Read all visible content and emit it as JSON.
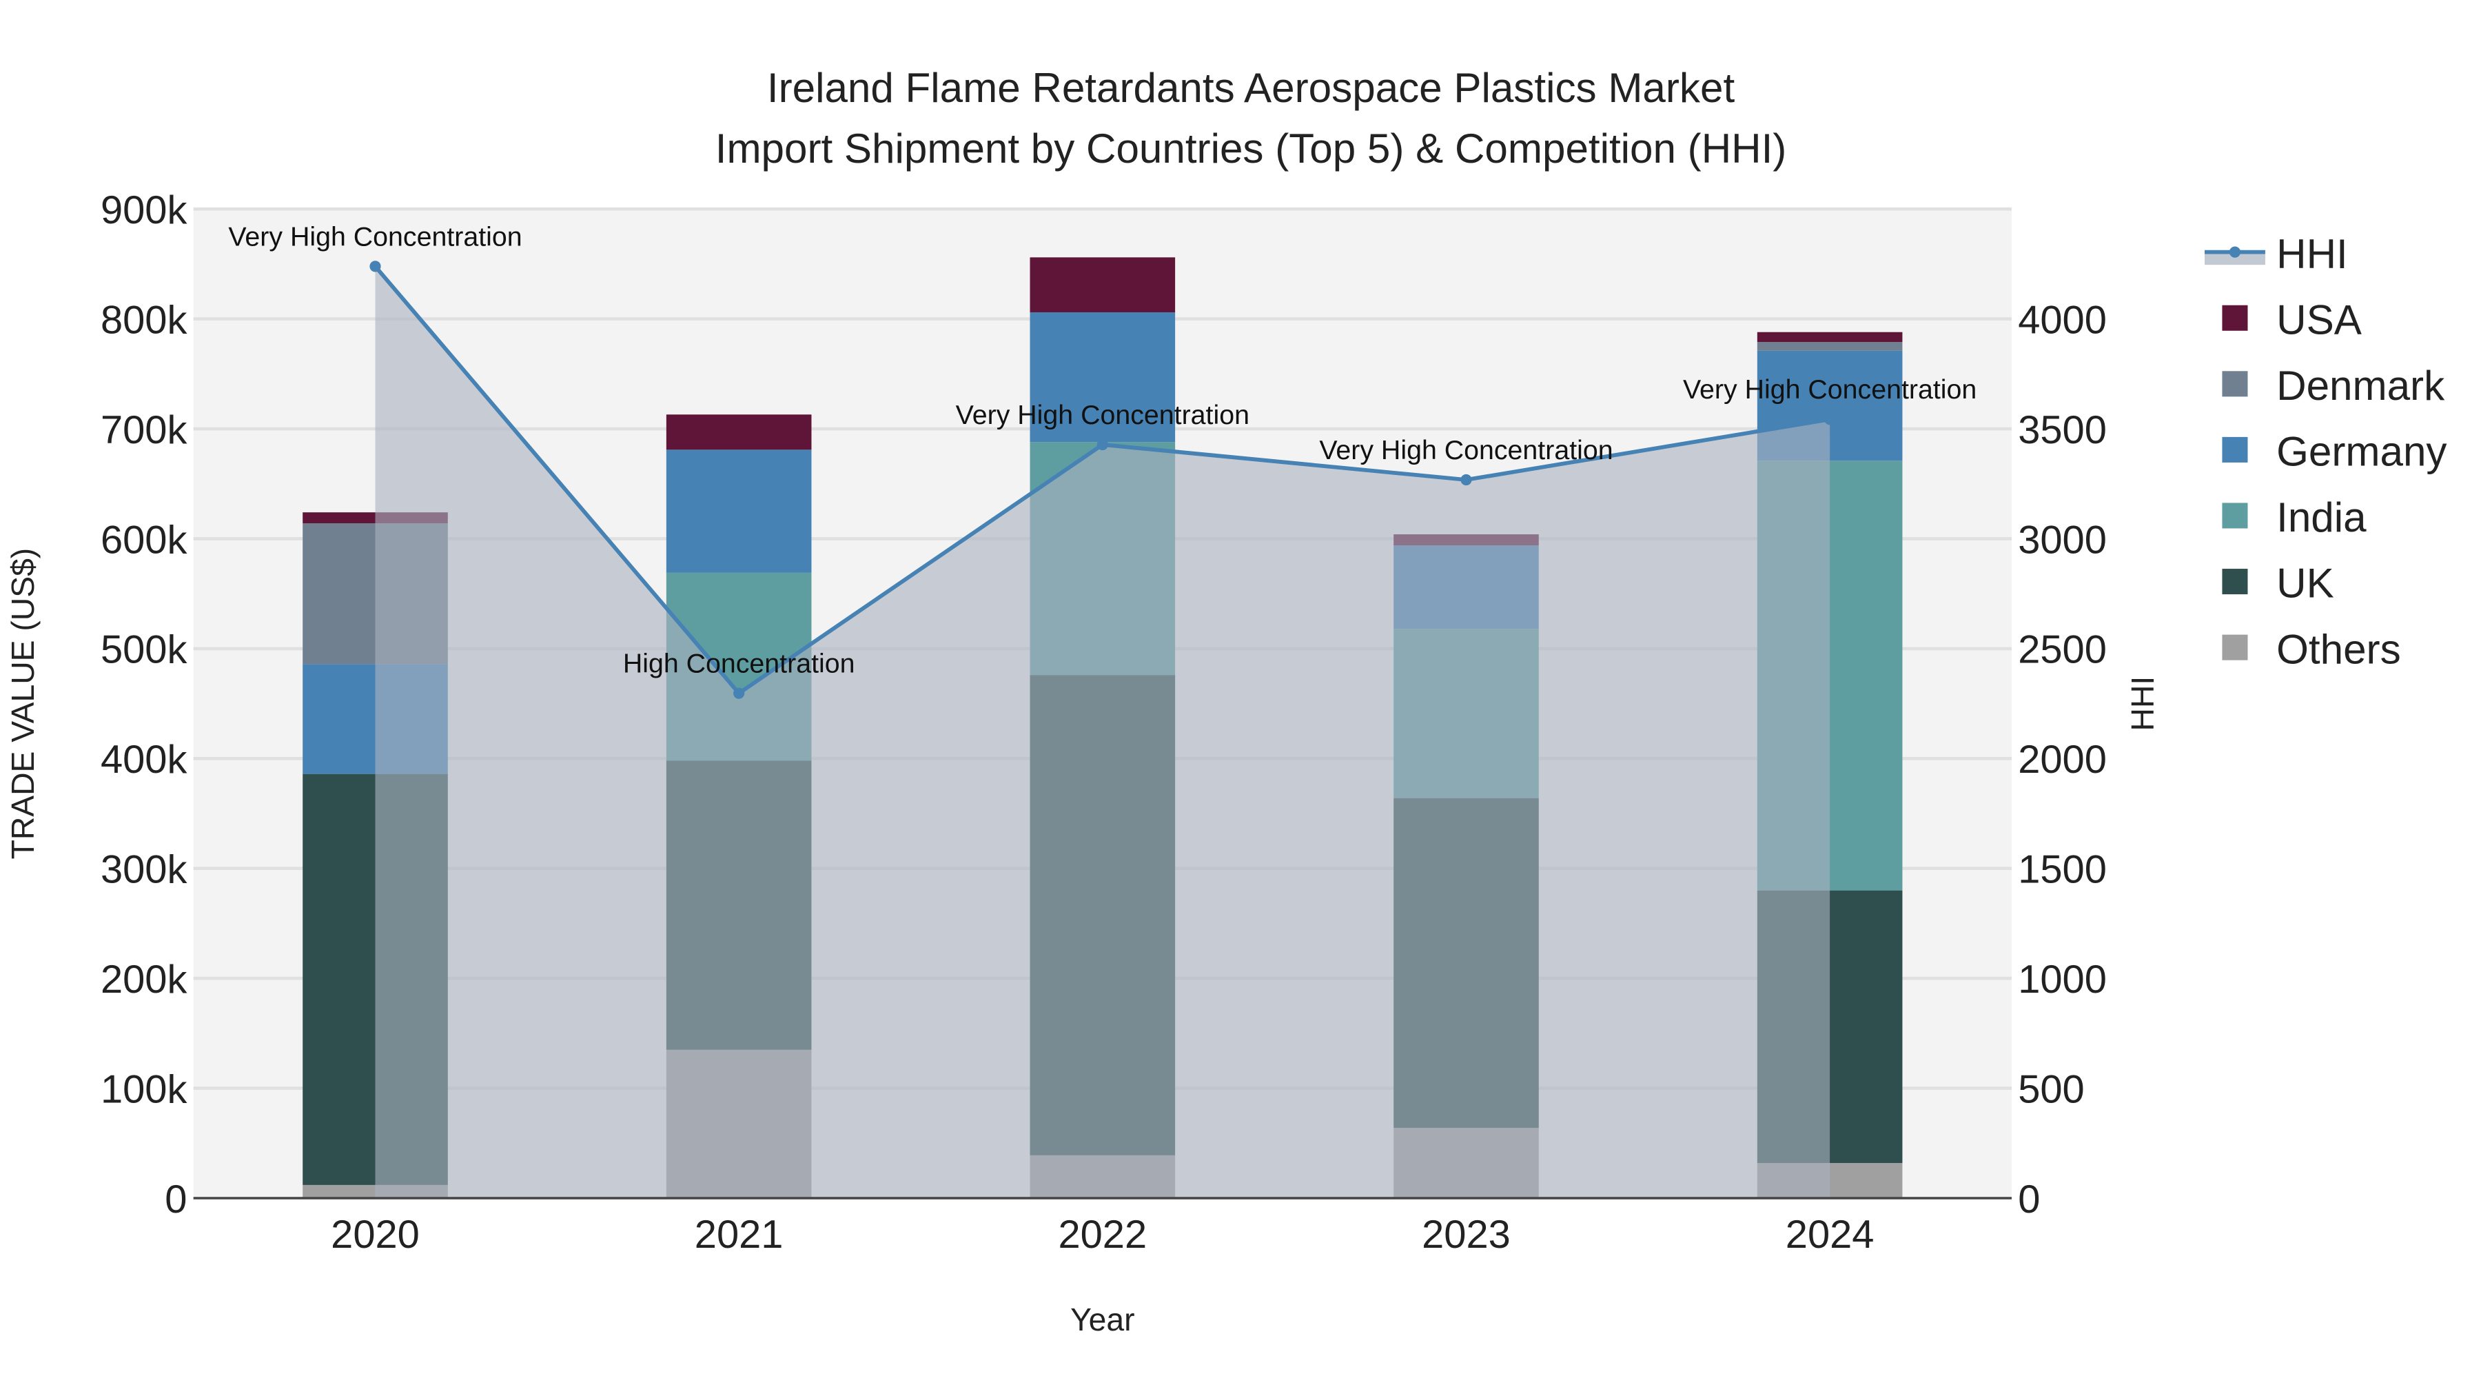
{
  "chart_data": {
    "type": "bar",
    "title_line1": "Ireland Flame Retardants Aerospace Plastics Market",
    "title_line2": "Import Shipment by Countries (Top 5) & Competition (HHI)",
    "xlabel": "Year",
    "ylabel": "TRADE VALUE (US$)",
    "y2label": "HHI",
    "categories": [
      "2020",
      "2021",
      "2022",
      "2023",
      "2024"
    ],
    "ylim": [
      0,
      900000
    ],
    "y2lim": [
      0,
      4500
    ],
    "yticks": [
      0,
      100000,
      200000,
      300000,
      400000,
      500000,
      600000,
      700000,
      800000,
      900000
    ],
    "ytick_labels": [
      "0",
      "100k",
      "200k",
      "300k",
      "400k",
      "500k",
      "600k",
      "700k",
      "800k",
      "900k"
    ],
    "y2ticks": [
      0,
      500,
      1000,
      1500,
      2000,
      2500,
      3000,
      3500,
      4000
    ],
    "y2tick_labels": [
      "0",
      "500",
      "1000",
      "1500",
      "2000",
      "2500",
      "3000",
      "3500",
      "4000"
    ],
    "stack_order": [
      "Others",
      "UK",
      "India",
      "Germany",
      "Denmark",
      "USA"
    ],
    "series": [
      {
        "name": "Others",
        "color": "#a0a0a0",
        "values": [
          12000,
          135000,
          39000,
          64000,
          32000
        ]
      },
      {
        "name": "UK",
        "color": "#2f4f4f",
        "values": [
          374000,
          263000,
          437000,
          300000,
          248000
        ]
      },
      {
        "name": "India",
        "color": "#5f9ea0",
        "values": [
          0,
          171000,
          212000,
          154000,
          391000
        ]
      },
      {
        "name": "Germany",
        "color": "#4682b4",
        "values": [
          100000,
          112000,
          118000,
          76000,
          100000
        ]
      },
      {
        "name": "Denmark",
        "color": "#708090",
        "values": [
          128000,
          0,
          0,
          0,
          8000
        ]
      },
      {
        "name": "USA",
        "color": "#5f1537",
        "values": [
          10000,
          32000,
          50000,
          10000,
          9000
        ]
      }
    ],
    "hhi": {
      "name": "HHI",
      "color": "#4682b4",
      "values": [
        4239,
        2297,
        3428,
        3268,
        3543
      ],
      "annotations": [
        "Very High Concentration",
        "High Concentration",
        "Very High Concentration",
        "Very High Concentration",
        "Very High Concentration"
      ]
    },
    "legend": [
      "HHI",
      "USA",
      "Denmark",
      "Germany",
      "India",
      "UK",
      "Others"
    ],
    "legend_position": "right",
    "grid": true
  }
}
